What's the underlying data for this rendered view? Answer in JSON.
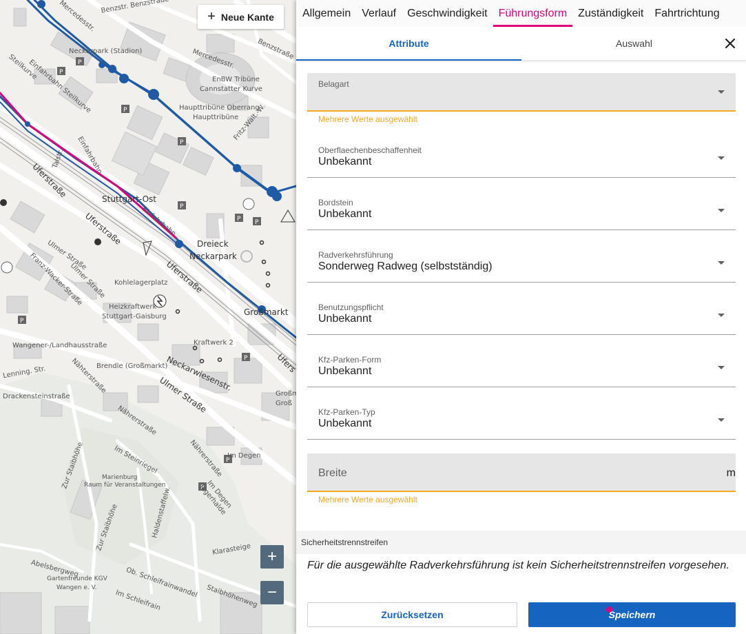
{
  "map": {
    "new_edge_button": {
      "icon": "plus-icon",
      "label": "Neue Kante"
    },
    "zoom_in_icon": "plus-icon",
    "zoom_out_icon": "minus-icon",
    "labels": [
      "Benzstr. Benzstraße",
      "Mercedesstr.",
      "Benzstraße",
      "Neckarpark (Stadion)",
      "Mercedesstr.",
      "EnBW Tribüne",
      "Cannstatter Kurve",
      "Haupttribüne Oberrang",
      "Haupttribüne",
      "Fritz-Walt.-W.",
      "Steilkurve",
      "Einfahrbahn Steilkurve",
      "Talstr.",
      "Einfahrbahn",
      "Uferstraße",
      "Stuttgart-Ost",
      "Einfahrbahn",
      "Uferstraße",
      "Dreieck",
      "Neckarpark",
      "Ulmer Straße",
      "Ulmer Straße",
      "Franz-Wacker-Straße",
      "Kohlelagerplatz",
      "Uferstraße",
      "Heizkraftwerk",
      "Stuttgart-Gaisburg",
      "Großmarkt",
      "Wangener-/Landhausstraße",
      "Kraftwerk 2",
      "Brendle (Großmarkt)",
      "Neckarwiesenstr.",
      "Lenning. Str.",
      "Drackensteinstraße",
      "Nähterstraße",
      "Ulmer Straße",
      "Nährerstraße",
      "Im Degen",
      "Zur Staibhöhe",
      "Im Steinriegel",
      "Marienburg",
      "Raum für Veranstaltungen",
      "Nährerstraße",
      "Jägerhalde",
      "Im Degen",
      "Haldenstaffelw.",
      "Zur Staibhöhe",
      "Klarasteige",
      "Abelsbergweg",
      "Gartenfreunde KGV",
      "Wangen e. V.",
      "Ob. Schleifrainwandel",
      "Im Schleifrain",
      "Staibhöhenweg",
      "Ufers",
      "Großm",
      "Groß"
    ]
  },
  "panel": {
    "tabs": [
      "Allgemein",
      "Verlauf",
      "Geschwindigkeit",
      "Führungsform",
      "Zuständigkeit",
      "Fahrtrichtung"
    ],
    "active_tab": "Führungsform",
    "subtabs": [
      "Attribute",
      "Auswahl"
    ],
    "active_subtab": "Attribute",
    "close_icon": "close-icon",
    "fields": {
      "belagart": {
        "label": "Belagart",
        "value": "",
        "hint": "Mehrere Werte ausgewählt"
      },
      "oberflaeche": {
        "label": "Oberflaechenbeschaffenheit",
        "value": "Unbekannt"
      },
      "bordstein": {
        "label": "Bordstein",
        "value": "Unbekannt"
      },
      "radverkehrsfuehrung": {
        "label": "Radverkehrsführung",
        "value": "Sonderweg Radweg (selbstständig)"
      },
      "benutzungspflicht": {
        "label": "Benutzungspflicht",
        "value": "Unbekannt"
      },
      "kfz_parken_form": {
        "label": "Kfz-Parken-Form",
        "value": "Unbekannt"
      },
      "kfz_parken_typ": {
        "label": "Kfz-Parken-Typ",
        "value": "Unbekannt"
      },
      "breite": {
        "placeholder": "Breite",
        "unit": "m",
        "hint": "Mehrere Werte ausgewählt"
      }
    },
    "section": {
      "title": "Sicherheitstrennstreifen",
      "note": "Für die ausgewählte Radverkehrsführung ist kein Sicherheitstrennstreifen vorgesehen."
    },
    "buttons": {
      "reset": "Zurücksetzen",
      "save": "Speichern"
    },
    "colors": {
      "accent": "#e0007a",
      "primary": "#1565c0",
      "warning": "#f5a623",
      "map_route": "#1f5aa6",
      "map_highlight": "#e0007a"
    }
  }
}
